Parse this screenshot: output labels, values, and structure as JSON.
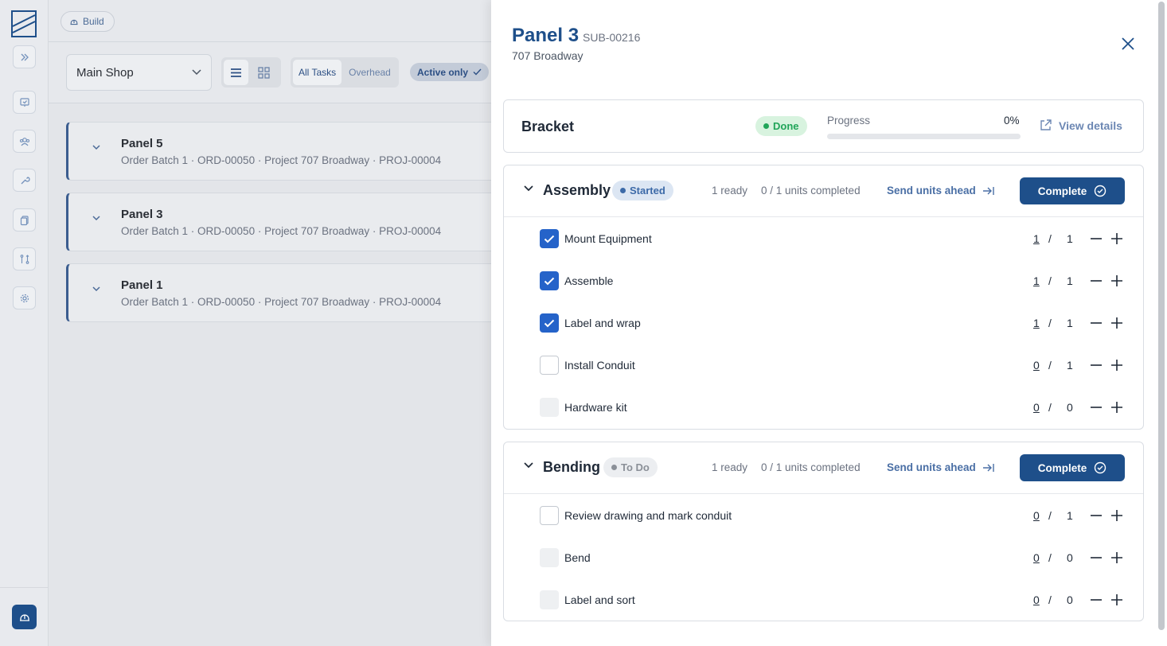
{
  "app": {
    "build_label": "Build"
  },
  "toolbar": {
    "shop": "Main Shop",
    "task_filters": [
      "All Tasks",
      "Overhead"
    ],
    "active_filter": "All Tasks",
    "active_only_label": "Active only"
  },
  "panels": [
    {
      "name": "Panel 5",
      "meta": "Order Batch 1 · ORD-00050 · Project 707 Broadway · PROJ-00004"
    },
    {
      "name": "Panel 3",
      "meta": "Order Batch 1 · ORD-00050 · Project 707 Broadway · PROJ-00004"
    },
    {
      "name": "Panel 1",
      "meta": "Order Batch 1 · ORD-00050 · Project 707 Broadway · PROJ-00004"
    }
  ],
  "drawer": {
    "title": "Panel 3",
    "code": "SUB-00216",
    "address": "707 Broadway",
    "bracket": {
      "name": "Bracket",
      "status": "Done",
      "progress_label": "Progress",
      "progress_value": "0%",
      "progress_fraction": 0,
      "view_details": "View details"
    },
    "sections": [
      {
        "name": "Assembly",
        "status": "Started",
        "ready": "1 ready",
        "units": "0 / 1 units completed",
        "send_label": "Send units ahead",
        "complete_label": "Complete",
        "tasks": [
          {
            "label": "Mount Equipment",
            "state": "checked",
            "done": "1",
            "total": "1"
          },
          {
            "label": "Assemble",
            "state": "checked",
            "done": "1",
            "total": "1"
          },
          {
            "label": "Label and wrap",
            "state": "checked",
            "done": "1",
            "total": "1"
          },
          {
            "label": "Install Conduit",
            "state": "empty",
            "done": "0",
            "total": "1"
          },
          {
            "label": "Hardware kit",
            "state": "disabled",
            "done": "0",
            "total": "0"
          }
        ]
      },
      {
        "name": "Bending",
        "status": "To Do",
        "ready": "1 ready",
        "units": "0 / 1 units completed",
        "send_label": "Send units ahead",
        "complete_label": "Complete",
        "tasks": [
          {
            "label": "Review drawing and mark conduit",
            "state": "empty",
            "done": "0",
            "total": "1"
          },
          {
            "label": "Bend",
            "state": "disabled",
            "done": "0",
            "total": "0"
          },
          {
            "label": "Label and sort",
            "state": "disabled",
            "done": "0",
            "total": "0"
          }
        ]
      }
    ],
    "slash": "/"
  },
  "colors": {
    "primary": "#1e4f8a",
    "checkbox": "#2563c9",
    "done_green": "#21a559",
    "started_blue": "#3c6aa8"
  },
  "icons": {
    "close": "x-icon",
    "chevron": "chevron-down-icon",
    "external": "external-link-icon",
    "complete": "check-circle-icon",
    "send": "arrow-right-to-line-icon"
  }
}
